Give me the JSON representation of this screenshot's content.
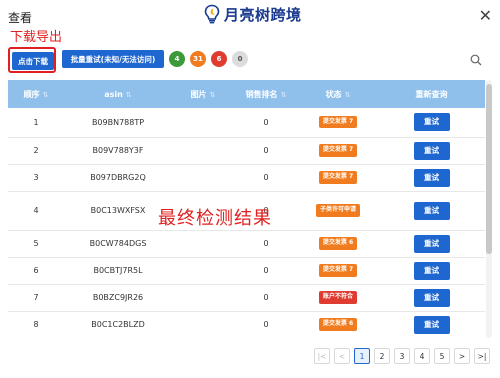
{
  "modal": {
    "title": "查看",
    "logo_text": "月亮树跨境",
    "close_symbol": "✕"
  },
  "annotations": {
    "top": "下载导出",
    "middle": "最终检测结果"
  },
  "toolbar": {
    "export_label": "点击下载",
    "batch_label": "批量重试(未知/无法访问)",
    "pills": [
      {
        "value": "4",
        "color": "#3d9a3a"
      },
      {
        "value": "31",
        "color": "#f07c1f"
      },
      {
        "value": "6",
        "color": "#e03b30"
      },
      {
        "value": "0",
        "color": "#dcdcdc",
        "text_color": "#555"
      }
    ]
  },
  "table": {
    "columns": [
      "顺序",
      "asin",
      "图片",
      "销售排名",
      "状态",
      "重新查询"
    ],
    "rows": [
      {
        "order": "1",
        "asin": "B09BN788TP",
        "rank": "0",
        "status": "提交发票 7",
        "status_color": "#f07c1f",
        "action": "重试"
      },
      {
        "order": "2",
        "asin": "B09V788Y3F",
        "rank": "0",
        "status": "提交发票 7",
        "status_color": "#f07c1f",
        "action": "重试"
      },
      {
        "order": "3",
        "asin": "B097DBRG2Q",
        "rank": "0",
        "status": "提交发票 7",
        "status_color": "#f07c1f",
        "action": "重试"
      },
      {
        "order": "4",
        "asin": "B0C13WXFSX",
        "rank": "0",
        "status": "子类许可申请",
        "status_color": "#f07c1f",
        "action": "重试"
      },
      {
        "order": "5",
        "asin": "B0CW784DGS",
        "rank": "0",
        "status": "提交发票 6",
        "status_color": "#f07c1f",
        "action": "重试"
      },
      {
        "order": "6",
        "asin": "B0CBTJ7R5L",
        "rank": "0",
        "status": "提交发票 7",
        "status_color": "#f07c1f",
        "action": "重试"
      },
      {
        "order": "7",
        "asin": "B0BZC9JR26",
        "rank": "0",
        "status": "账户不符合",
        "status_color": "#e03b30",
        "action": "重试"
      },
      {
        "order": "8",
        "asin": "B0C1C2BLZD",
        "rank": "0",
        "status": "提交发票 6",
        "status_color": "#f07c1f",
        "action": "重试"
      }
    ]
  },
  "pagination": {
    "first": "|<",
    "prev": "<",
    "pages": [
      "1",
      "2",
      "3",
      "4",
      "5"
    ],
    "active": "1",
    "next": ">",
    "last": ">|"
  },
  "colors": {
    "accent": "#1e66d0",
    "header_bg": "#8fc0ec",
    "annotation": "#e02020"
  }
}
